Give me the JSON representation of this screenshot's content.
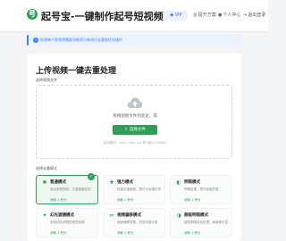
{
  "header": {
    "logo_letter": "号",
    "title": "起号宝-一键制作起号短视频",
    "vip": "VIP",
    "nav": [
      {
        "icon": "upgrade-icon",
        "glyph": "▥",
        "label": "提升方案"
      },
      {
        "icon": "user-icon",
        "glyph": "●",
        "label": "个人中心"
      },
      {
        "icon": "logout-icon",
        "glyph": "⇥",
        "label": "退出登录"
      }
    ]
  },
  "notice": {
    "text": "处理每个视频将需要消耗积分来进行去重和优化操作"
  },
  "main": {
    "title": "上传视频一键去重处理",
    "upload_label": "选择视频文件",
    "drop_text": "拖拽视频文件到此处，或",
    "select_button": "选择文件",
    "support_text": "支持格式：mp4, mov, avi 等 (最大200MB)",
    "mode_label": "选择去重模式",
    "modes": [
      {
        "icon": "star-icon",
        "glyph": "✱",
        "name": "普通模式",
        "desc": "适合常规视频，去重程度较低",
        "cost": "消耗 1 积分",
        "selected": true
      },
      {
        "icon": "lightning-icon",
        "glyph": "✚",
        "name": "强力模式",
        "desc": "较高去重程度，提升平台通过率",
        "cost": "消耗 1 积分",
        "selected": false
      },
      {
        "icon": "brightness-icon",
        "glyph": "◐",
        "name": "明暗模式",
        "desc": "明暗处理，提升画面质感",
        "cost": "消耗 1 积分",
        "selected": false
      },
      {
        "icon": "filter-icon",
        "glyph": "✦",
        "name": "幻光滤镜模式",
        "desc": "添加特效滤镜的视觉效果",
        "cost": "消耗 1 积分",
        "selected": false
      },
      {
        "icon": "equalizer-icon",
        "glyph": "⇌",
        "name": "视频偏移模式",
        "desc": "画面偏移效果，实现深度去重",
        "cost": "消耗 1 积分",
        "selected": false
      },
      {
        "icon": "contrast-icon",
        "glyph": "◑",
        "name": "超级明暗模式",
        "desc": "超强明暗变化处理，画面更丰富",
        "cost": "消耗 1 积分",
        "selected": false
      }
    ]
  },
  "colors": {
    "accent": "#2f9e57",
    "notice": "#3b82f6",
    "background": "#f2f4f5"
  }
}
